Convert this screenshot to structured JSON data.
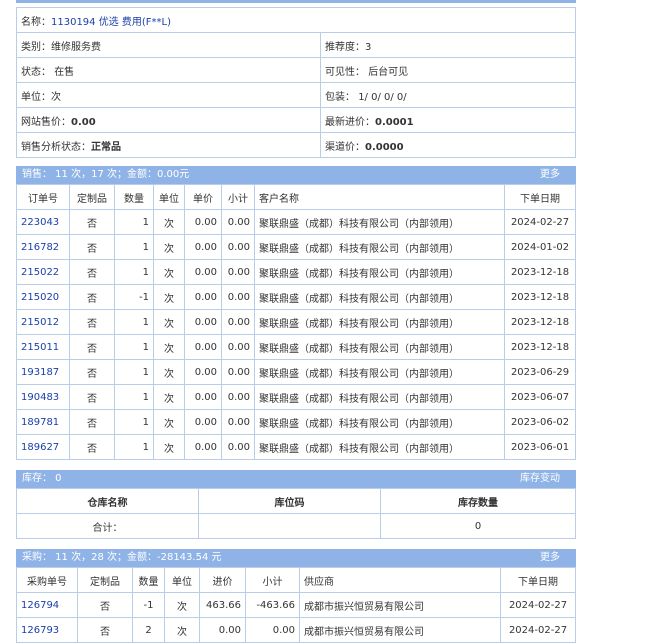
{
  "info": {
    "name_label": "名称：",
    "name_value": "1130194 优选 费用(F**L)",
    "category_label": "类别：",
    "category_value": "维修服务费",
    "recommend_label": "推荐度：",
    "recommend_value": "3",
    "status_label": "状态：",
    "status_value": "在售",
    "visibility_label": "可见性：",
    "visibility_value": "后台可见",
    "unit_label": "单位：",
    "unit_value": "次",
    "package_label": "包装：",
    "package_value": "1/ 0/ 0/ 0/",
    "site_price_label": "网站售价：",
    "site_price_value": "0.00",
    "latest_cost_label": "最新进价：",
    "latest_cost_value": "0.0001",
    "sales_status_label": "销售分析状态：",
    "sales_status_value": "正常品",
    "channel_price_label": "渠道价：",
    "channel_price_value": "0.0000"
  },
  "sales": {
    "header": "销售： 11 次，17 次；金额：0.00元",
    "more": "更多",
    "columns": [
      "订单号",
      "定制品",
      "数量",
      "单位",
      "单价",
      "小计",
      "客户名称",
      "下单日期"
    ],
    "rows": [
      [
        "223043",
        "否",
        "1",
        "次",
        "0.00",
        "0.00",
        "聚联鼎盛（成都）科技有限公司（内部领用）",
        "2024-02-27"
      ],
      [
        "216782",
        "否",
        "1",
        "次",
        "0.00",
        "0.00",
        "聚联鼎盛（成都）科技有限公司（内部领用）",
        "2024-01-02"
      ],
      [
        "215022",
        "否",
        "1",
        "次",
        "0.00",
        "0.00",
        "聚联鼎盛（成都）科技有限公司（内部领用）",
        "2023-12-18"
      ],
      [
        "215020",
        "否",
        "-1",
        "次",
        "0.00",
        "0.00",
        "聚联鼎盛（成都）科技有限公司（内部领用）",
        "2023-12-18"
      ],
      [
        "215012",
        "否",
        "1",
        "次",
        "0.00",
        "0.00",
        "聚联鼎盛（成都）科技有限公司（内部领用）",
        "2023-12-18"
      ],
      [
        "215011",
        "否",
        "1",
        "次",
        "0.00",
        "0.00",
        "聚联鼎盛（成都）科技有限公司（内部领用）",
        "2023-12-18"
      ],
      [
        "193187",
        "否",
        "1",
        "次",
        "0.00",
        "0.00",
        "聚联鼎盛（成都）科技有限公司（内部领用）",
        "2023-06-29"
      ],
      [
        "190483",
        "否",
        "1",
        "次",
        "0.00",
        "0.00",
        "聚联鼎盛（成都）科技有限公司（内部领用）",
        "2023-06-07"
      ],
      [
        "189781",
        "否",
        "1",
        "次",
        "0.00",
        "0.00",
        "聚联鼎盛（成都）科技有限公司（内部领用）",
        "2023-06-02"
      ],
      [
        "189627",
        "否",
        "1",
        "次",
        "0.00",
        "0.00",
        "聚联鼎盛（成都）科技有限公司（内部领用）",
        "2023-06-01"
      ]
    ]
  },
  "stock": {
    "header": "库存： 0",
    "more": "库存变动",
    "columns": [
      "仓库名称",
      "库位码",
      "库存数量"
    ],
    "total_label": "合计：",
    "total_qty": "0"
  },
  "purchase": {
    "header": "采购： 11 次，28 次；金额：-28143.54 元",
    "more": "更多",
    "columns": [
      "采购单号",
      "定制品",
      "数量",
      "单位",
      "进价",
      "小计",
      "供应商",
      "下单日期"
    ],
    "rows": [
      [
        "126794",
        "否",
        "-1",
        "次",
        "463.66",
        "-463.66",
        "成都市振兴恒贸易有限公司",
        "2024-02-27"
      ],
      [
        "126793",
        "否",
        "2",
        "次",
        "0.00",
        "0.00",
        "成都市振兴恒贸易有限公司",
        "2024-02-27"
      ]
    ]
  }
}
